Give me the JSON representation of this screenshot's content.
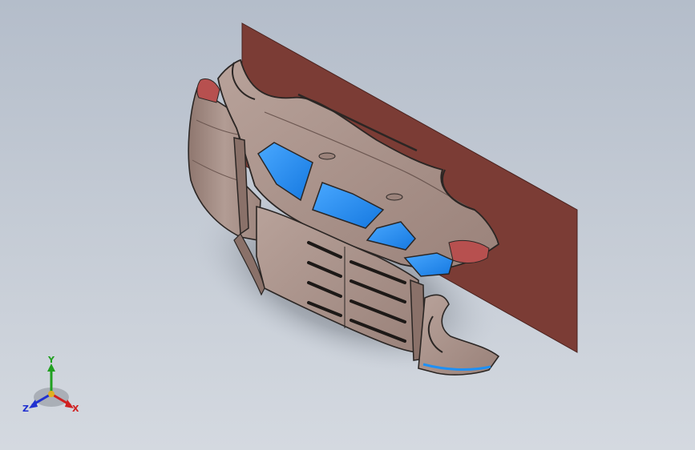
{
  "viewport": {
    "background_top": "#b4bdca",
    "background_bottom": "#d4d9e0"
  },
  "model": {
    "body_color": "#a89088",
    "body_shade": "#8a7169",
    "glass_color": "#1e90f5",
    "plane_color": "#7b3c35",
    "taillight_color": "#b7504f",
    "edge_color": "#2b2624"
  },
  "triad": {
    "x_label": "X",
    "y_label": "Y",
    "z_label": "Z",
    "x_color": "#d02020",
    "y_color": "#20a020",
    "z_color": "#2030d0"
  }
}
